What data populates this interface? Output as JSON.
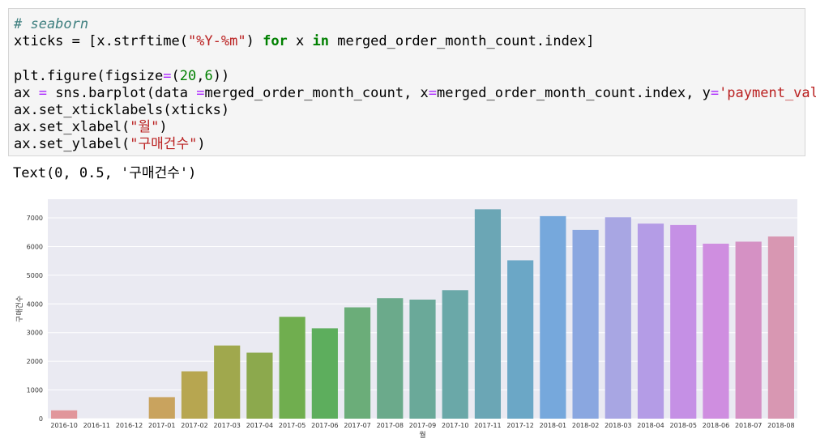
{
  "code": {
    "comment": "# seaborn",
    "line2": {
      "pre": "xticks = [x.strftime(",
      "fmt": "\"%Y-%m\"",
      "mid": ") ",
      "kw_for": "for",
      "mid2": " x ",
      "kw_in": "in",
      "post": " merged_order_month_count.index]"
    },
    "line4": {
      "pre": "plt.figure(figsize",
      "eq": "=",
      "paren": "(",
      "n1": "20",
      "comma": ",",
      "n2": "6",
      "post": "))"
    },
    "line5": {
      "pre": "ax ",
      "eq": "=",
      "mid": " sns.barplot(data ",
      "eq2": "=",
      "mid2": "merged_order_month_count, x",
      "eq3": "=",
      "mid3": "merged_order_month_count.index, y",
      "eq4": "=",
      "str": "'payment_value'",
      "post": ")"
    },
    "line6": "ax.set_xticklabels(xticks)",
    "line7": {
      "pre": "ax.set_xlabel(",
      "str": "\"월\"",
      "post": ")"
    },
    "line8": {
      "pre": "ax.set_ylabel(",
      "str": "\"구매건수\"",
      "post": ")"
    }
  },
  "output": {
    "text": "Text(0, 0.5, '구매건수')"
  },
  "chart_data": {
    "type": "bar",
    "title": "",
    "xlabel": "월",
    "ylabel": "구매건수",
    "ylim": [
      0,
      7650
    ],
    "yticks": [
      0,
      1000,
      2000,
      3000,
      4000,
      5000,
      6000,
      7000
    ],
    "grid": true,
    "categories": [
      "2016-10",
      "2016-11",
      "2016-12",
      "2017-01",
      "2017-02",
      "2017-03",
      "2017-04",
      "2017-05",
      "2017-06",
      "2017-07",
      "2017-08",
      "2017-09",
      "2017-10",
      "2017-11",
      "2017-12",
      "2018-01",
      "2018-02",
      "2018-03",
      "2018-04",
      "2018-05",
      "2018-06",
      "2018-07",
      "2018-08"
    ],
    "values": [
      290,
      0,
      0,
      750,
      1650,
      2550,
      2300,
      3550,
      3150,
      3880,
      4200,
      4150,
      4480,
      7300,
      5520,
      7060,
      6580,
      7020,
      6800,
      6750,
      6100,
      6170,
      6350
    ],
    "colors": [
      "#e1969b",
      "#dda088",
      "#d6a779",
      "#c9a35e",
      "#b7a650",
      "#a0a84d",
      "#8ca94d",
      "#70ae4f",
      "#5dae5d",
      "#6bad79",
      "#6baa8b",
      "#6aa999",
      "#6aa8a8",
      "#6ba6b5",
      "#6ba7c6",
      "#76a8dc",
      "#8aa7e0",
      "#a8a6e3",
      "#b49ce6",
      "#c590e5",
      "#cf8ee0",
      "#d591c4",
      "#d897b2"
    ],
    "background": "#eaeaf2"
  }
}
